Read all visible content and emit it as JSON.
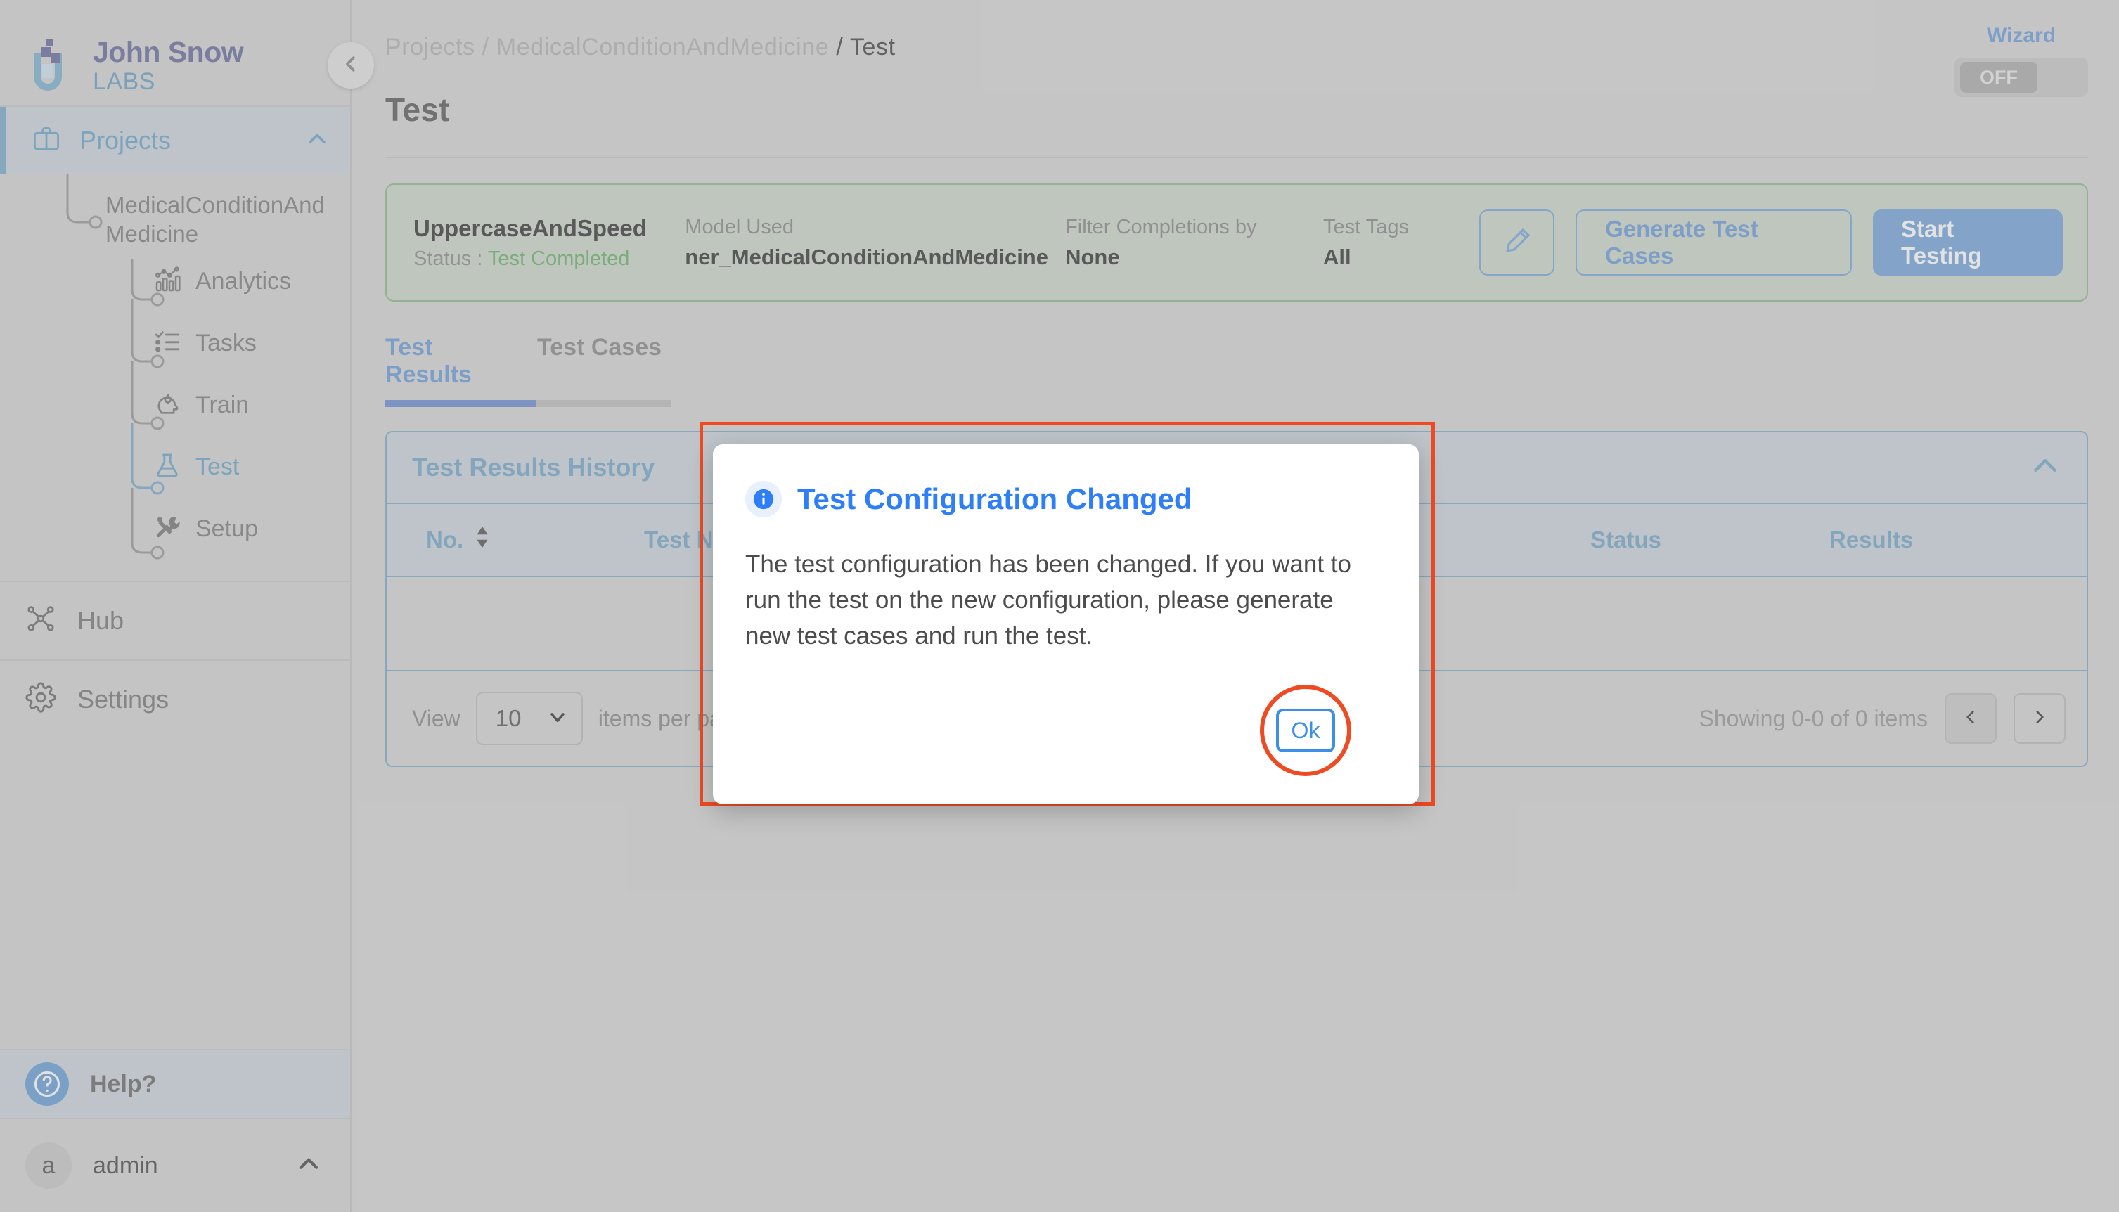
{
  "brand": {
    "name": "John Snow",
    "sub": "LABS"
  },
  "sidebar": {
    "projects": {
      "label": "Projects",
      "icon": "briefcase-icon",
      "chevron": "chevron-up-icon"
    },
    "project_name": "MedicalConditionAndMedicine",
    "tree_items": [
      {
        "label": "Analytics",
        "icon": "analytics-icon",
        "active": false
      },
      {
        "label": "Tasks",
        "icon": "tasks-icon",
        "active": false
      },
      {
        "label": "Train",
        "icon": "train-brain-icon",
        "active": false
      },
      {
        "label": "Test",
        "icon": "flask-icon",
        "active": true
      },
      {
        "label": "Setup",
        "icon": "tools-icon",
        "active": false
      }
    ],
    "flat_items": [
      {
        "label": "Hub",
        "icon": "hub-nodes-icon"
      },
      {
        "label": "Settings",
        "icon": "gear-icon"
      }
    ],
    "help": {
      "label": "Help?",
      "icon": "question-circle-icon"
    },
    "user": {
      "initial": "a",
      "name": "admin",
      "chevron": "chevron-up-icon"
    }
  },
  "header": {
    "breadcrumb": {
      "root": "Projects",
      "sep1": "/",
      "project": "MedicalConditionAndMedicine",
      "sep2": "/",
      "current": "Test"
    },
    "page_title": "Test",
    "wizard": {
      "label": "Wizard",
      "state": "OFF"
    }
  },
  "config_bar": {
    "test_name": "UppercaseAndSpeed",
    "status_prefix": "Status :",
    "status_value": "Test Completed",
    "model_key": "Model Used",
    "model_value": "ner_MedicalConditionAndMedicine",
    "filter_key": "Filter Completions by",
    "filter_value": "None",
    "tags_key": "Test Tags",
    "tags_value": "All",
    "edit_icon": "pencil-icon",
    "generate_label": "Generate Test Cases",
    "start_label": "Start Testing"
  },
  "tabs": [
    {
      "label": "Test Results",
      "active": true
    },
    {
      "label": "Test Cases",
      "active": false
    }
  ],
  "panel": {
    "title": "Test Results History",
    "collapse_icon": "chevron-up-icon",
    "columns": [
      {
        "label": "No.",
        "sort_icon": "sort-updown-icon"
      },
      {
        "label": "Test Name"
      },
      {
        "label": "Status"
      },
      {
        "label": "Results"
      }
    ],
    "rows": [],
    "footer": {
      "view_label": "View",
      "page_size": "10",
      "page_size_chevron": "chevron-down-icon",
      "items_per_page_label": "items per page",
      "showing": "Showing 0-0 of 0 items",
      "prev_icon": "chevron-left-icon",
      "next_icon": "chevron-right-icon"
    }
  },
  "modal": {
    "icon": "info-icon",
    "title": "Test Configuration Changed",
    "body": "The test configuration has been changed. If you want to run the test on the new configuration, please generate new test cases and run the test.",
    "ok_label": "Ok"
  },
  "colors": {
    "accent_blue": "#6f9fd8",
    "panel_blue": "#7badcc",
    "highlight_red": "#ee4b23",
    "status_green": "#6cb36c",
    "config_bg": "#cdd7cc",
    "config_border": "#8dba8d",
    "modal_title_blue": "#2d7ef7"
  }
}
